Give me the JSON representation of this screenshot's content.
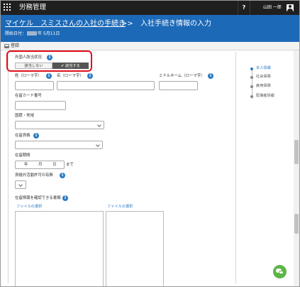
{
  "app": {
    "title": "労務管理"
  },
  "topbar": {
    "help": "?",
    "user_name": "山田 一郎"
  },
  "header": {
    "breadcrumb_link": "マイケル　スミスさんの入社の手続き",
    "separator": ">>",
    "current_page": "入社手続き情報の入力",
    "start_date_label": "開始日付：",
    "start_date_value": "年 5月11日"
  },
  "toolbar": {
    "register_label": "登録"
  },
  "form": {
    "foreign_status": {
      "label": "外国人該当状況",
      "options": [
        "該当しない",
        "✔ 該当する"
      ],
      "selected": "✔ 該当する"
    },
    "last_name_label": "姓（ローマ字）",
    "first_name_label": "名（ローマ字）",
    "middle_name_label": "ミドルネーム（ローマ字）",
    "residence_card_label": "在留カード番号",
    "nationality_label": "国籍・地域",
    "residence_status_label": "在留資格",
    "residence_period_label": "在留期間",
    "period_year": "年",
    "period_month": "月",
    "period_day": "日",
    "period_until": "まで",
    "work_permit_label": "資格外活動許可の有無",
    "documents_label": "在留情報を確認できる書類",
    "file_select_1": "ファイルの選択",
    "file_select_2": "ファイルの選択"
  },
  "side_nav": {
    "items": [
      {
        "label": "本人情報",
        "active": true
      },
      {
        "label": "社会保険",
        "active": false
      },
      {
        "label": "雇用保険",
        "active": false
      },
      {
        "label": "配偶者情報",
        "active": false
      }
    ]
  },
  "colors": {
    "accent": "#1c69b8",
    "highlight": "#e0101a",
    "chat": "#5cb646"
  },
  "icons": {
    "chat": "chat-icon",
    "info": "info-icon",
    "user": "user-icon",
    "apps": "apps-grid-icon"
  }
}
